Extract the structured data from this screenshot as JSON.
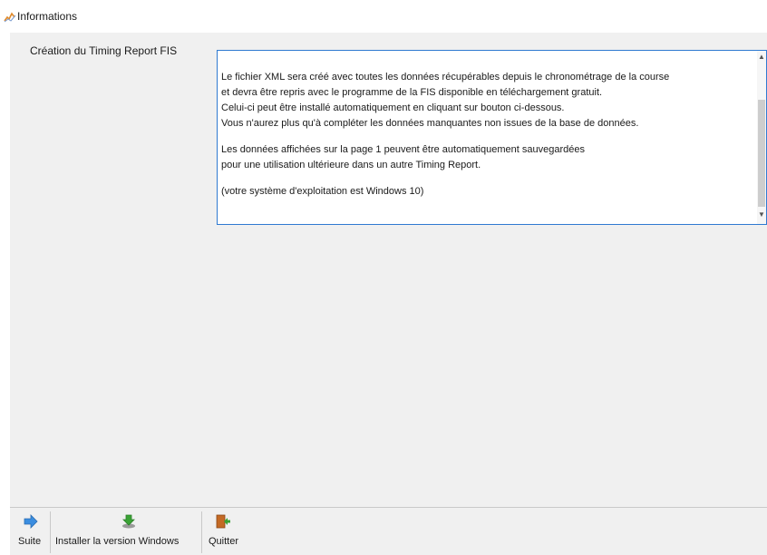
{
  "window": {
    "title": "Informations"
  },
  "section": {
    "label": "Création du Timing Report FIS"
  },
  "message": {
    "lines": [
      "Le fichier XML sera créé avec toutes les données récupérables depuis le chronométrage de la course",
      "et devra être repris avec le programme de la FIS disponible en téléchargement gratuit.",
      "Celui-ci peut être installé automatiquement en cliquant sur bouton ci-dessous.",
      "Vous n'aurez plus qu'à compléter les données manquantes non issues de la base de données.",
      "Les données affichées sur la page 1 peuvent être automatiquement sauvegardées",
      "pour une utilisation ultérieure dans un autre Timing Report.",
      "(votre système d'exploitation est Windows 10)"
    ]
  },
  "toolbar": {
    "suite_label": "Suite",
    "install_label": "Installer la version Windows",
    "quit_label": "Quitter"
  },
  "icons": {
    "app": "app-chart-icon",
    "suite": "arrow-right-icon",
    "install": "download-install-icon",
    "quit": "exit-door-icon"
  },
  "colors": {
    "panel": "#f0f0f0",
    "textbox_border": "#2f7ad1",
    "suite_arrow": "#3a8de0",
    "install_green": "#3aa335",
    "quit_door": "#c46a25"
  }
}
